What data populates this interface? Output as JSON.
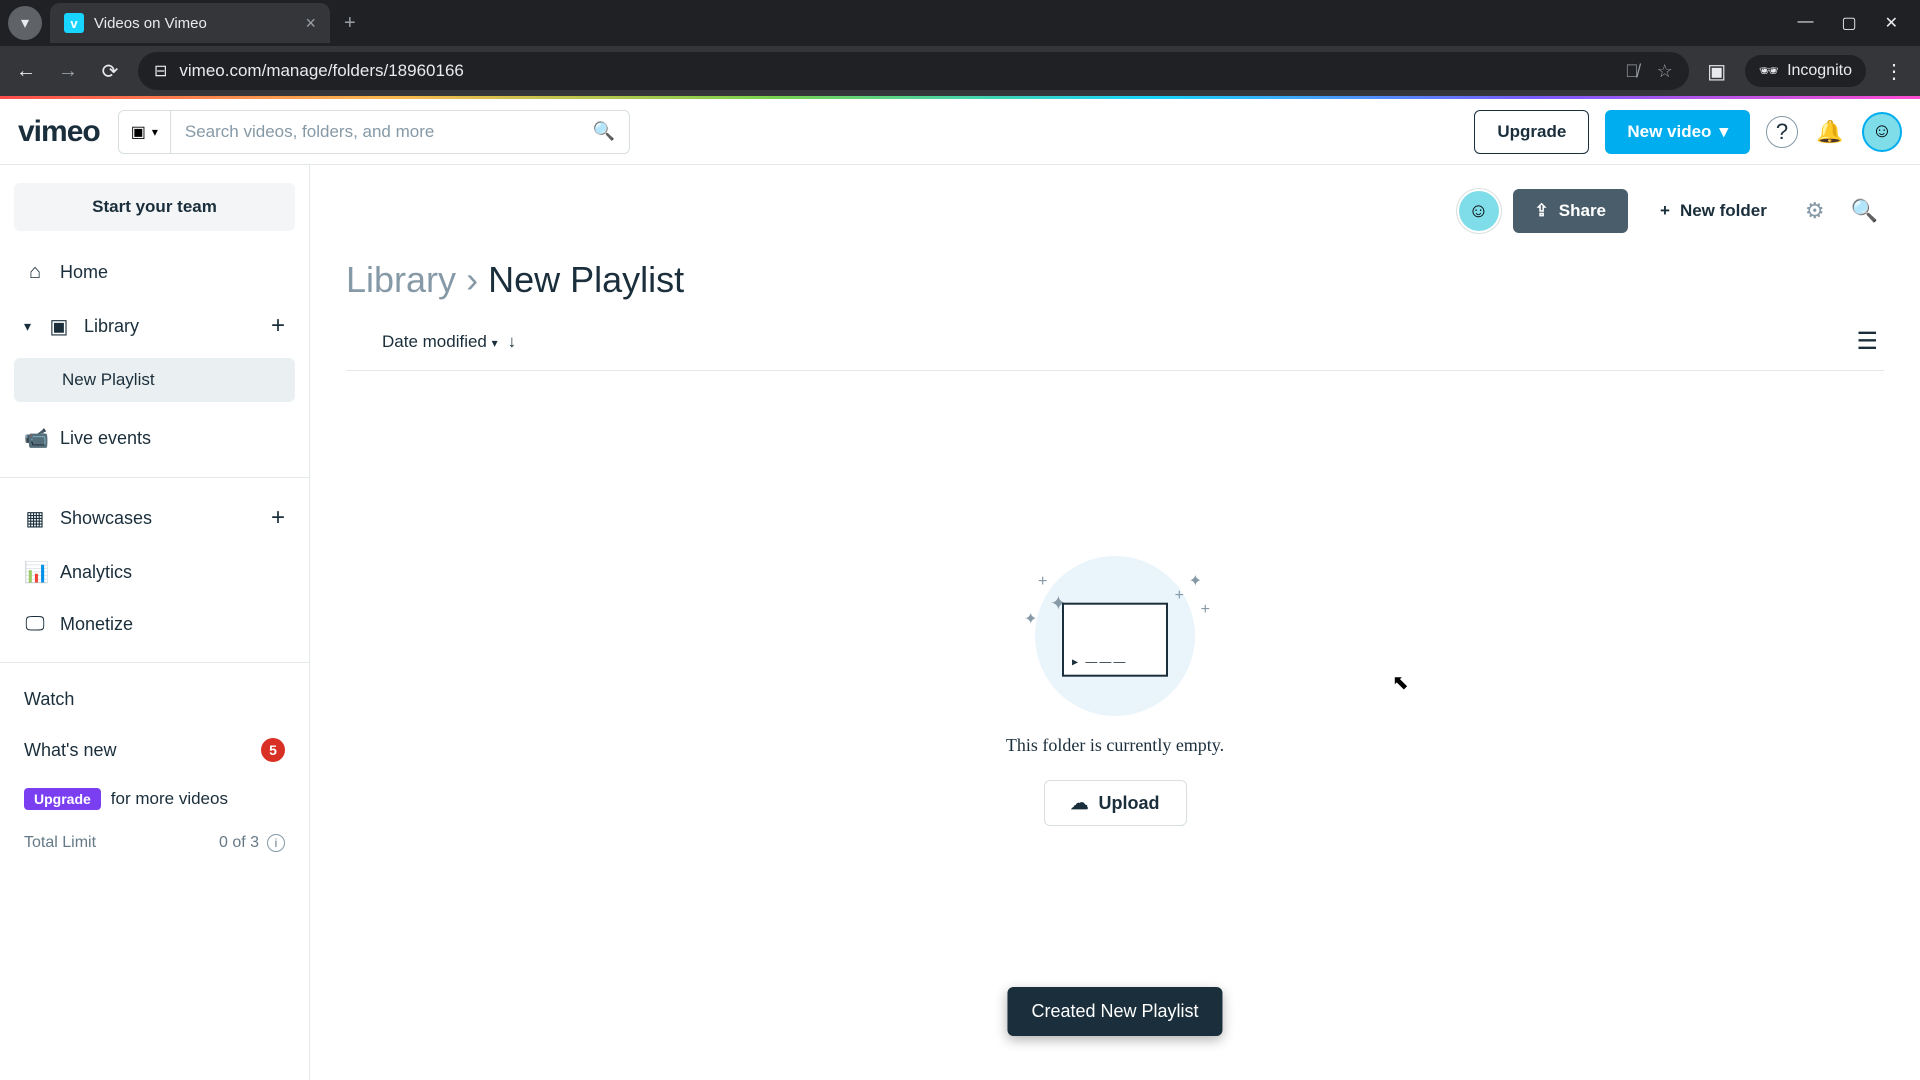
{
  "browser": {
    "tab_title": "Videos on Vimeo",
    "url": "vimeo.com/manage/folders/18960166",
    "incognito_label": "Incognito"
  },
  "header": {
    "logo": "vimeo",
    "search_placeholder": "Search videos, folders, and more",
    "upgrade": "Upgrade",
    "new_video": "New video"
  },
  "sidebar": {
    "start_team": "Start your team",
    "home": "Home",
    "library": "Library",
    "library_child": "New Playlist",
    "live_events": "Live events",
    "showcases": "Showcases",
    "analytics": "Analytics",
    "monetize": "Monetize",
    "watch": "Watch",
    "whats_new": "What's new",
    "whats_new_badge": "5",
    "upgrade_pill": "Upgrade",
    "upgrade_text": "for more videos",
    "total_limit_label": "Total Limit",
    "total_limit_value": "0 of 3"
  },
  "main": {
    "share": "Share",
    "new_folder": "New folder",
    "breadcrumb_root": "Library",
    "breadcrumb_sep": "›",
    "breadcrumb_current": "New Playlist",
    "sort_label": "Date modified",
    "empty_text": "This folder is currently empty.",
    "upload": "Upload",
    "toast": "Created New Playlist"
  }
}
